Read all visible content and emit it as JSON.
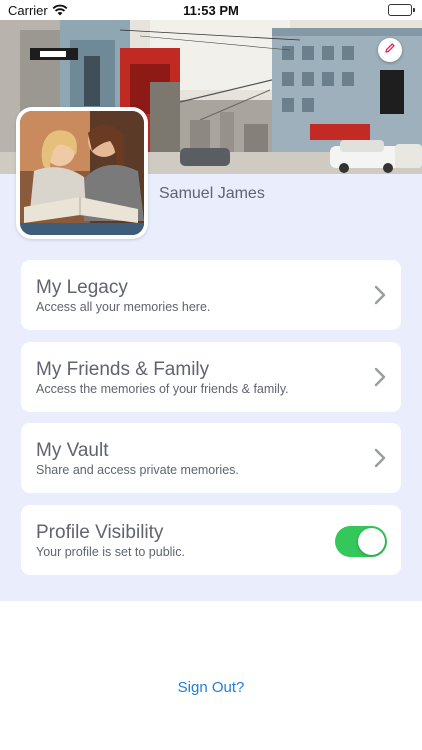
{
  "status_bar": {
    "carrier": "Carrier",
    "time": "11:53 PM"
  },
  "profile": {
    "name": "Samuel James"
  },
  "menu": [
    {
      "title": "My Legacy",
      "subtitle": "Access all your memories here."
    },
    {
      "title": "My Friends & Family",
      "subtitle": "Access the memories of your friends & family."
    },
    {
      "title": "My Vault",
      "subtitle": "Share and access private memories."
    }
  ],
  "visibility": {
    "title": "Profile Visibility",
    "subtitle": "Your profile is set to public.",
    "enabled": true
  },
  "sign_out": "Sign Out?",
  "colors": {
    "background_panel": "#eaedfb",
    "toggle_on": "#34c759",
    "link": "#1e7fd8",
    "text": "#5f6470"
  },
  "icons": {
    "wifi": "wifi-icon",
    "battery": "battery-icon",
    "edit": "pencil-icon",
    "chevron": "chevron-right-icon"
  }
}
